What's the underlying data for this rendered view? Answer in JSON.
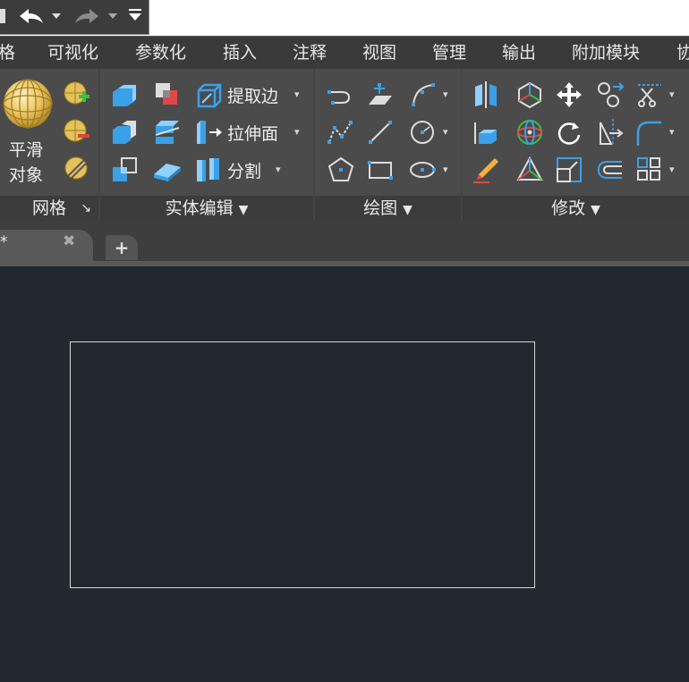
{
  "quick_access": {
    "icons": [
      "save-icon",
      "undo-icon",
      "redo-icon",
      "customize-icon"
    ]
  },
  "menu": [
    {
      "id": "mesh-partial",
      "label": "格"
    },
    {
      "id": "visualize",
      "label": "可视化"
    },
    {
      "id": "parametric",
      "label": "参数化"
    },
    {
      "id": "insert",
      "label": "插入"
    },
    {
      "id": "annotate",
      "label": "注释"
    },
    {
      "id": "view",
      "label": "视图"
    },
    {
      "id": "manage",
      "label": "管理"
    },
    {
      "id": "output",
      "label": "输出"
    },
    {
      "id": "addins",
      "label": "附加模块"
    },
    {
      "id": "collaborate-partial",
      "label": "协"
    }
  ],
  "ribbon": {
    "mesh": {
      "title": "网格",
      "smooth_label_1": "平滑",
      "smooth_label_2": "对象",
      "launcher": "↘"
    },
    "solid_edit": {
      "title": "实体编辑",
      "extract_edges": "提取边",
      "extrude_faces": "拉伸面",
      "separate": "分割"
    },
    "draw": {
      "title": "绘图"
    },
    "modify": {
      "title": "修改"
    }
  },
  "tabs": {
    "document_label": "*",
    "add_label": "+"
  }
}
